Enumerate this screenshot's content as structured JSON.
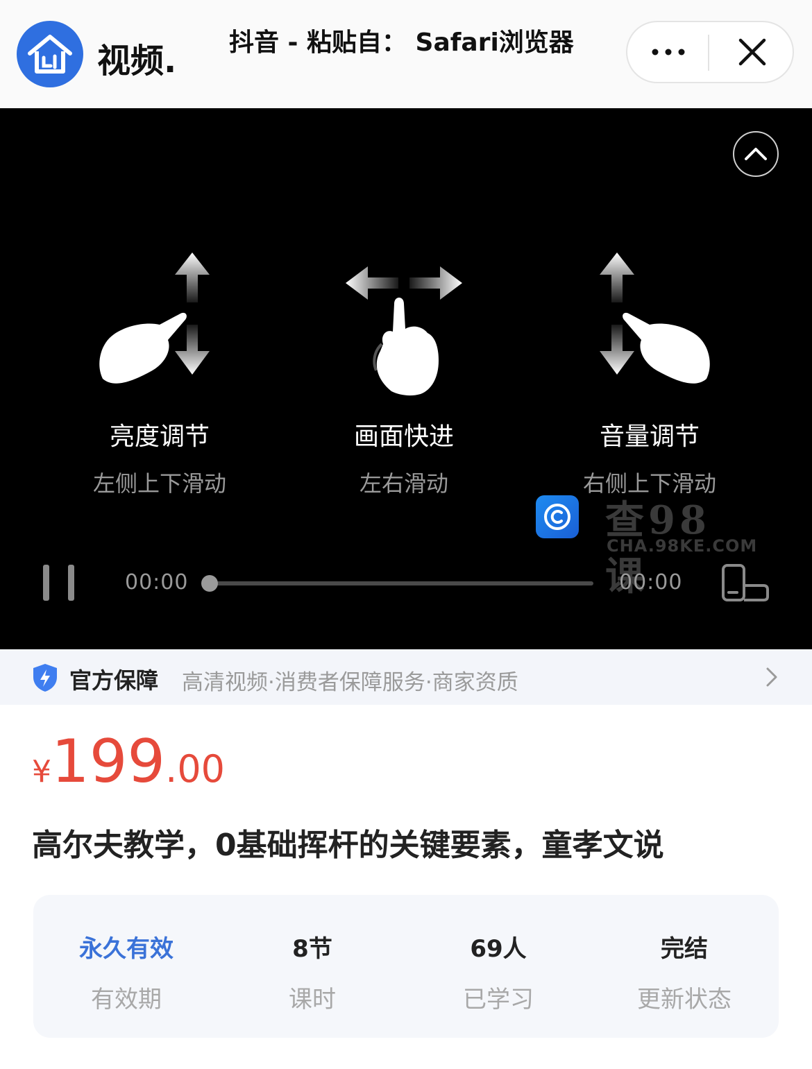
{
  "header": {
    "app_name": "视频.",
    "notice": "抖音 - 粘贴自： Safari浏览器",
    "more_label": "•••",
    "logo_icon": "house-logo-icon",
    "close_icon": "close-icon"
  },
  "player": {
    "gestures": [
      {
        "title": "亮度调节",
        "subtitle": "左侧上下滑动",
        "icon": "swipe-vertical-left-icon"
      },
      {
        "title": "画面快进",
        "subtitle": "左右滑动",
        "icon": "swipe-horizontal-icon"
      },
      {
        "title": "音量调节",
        "subtitle": "右侧上下滑动",
        "icon": "swipe-vertical-right-icon"
      }
    ],
    "current_time": "00:00",
    "total_time": "00:00",
    "progress": 0,
    "watermark": {
      "cn": "查98课",
      "en": "CHA.98KE.COM"
    }
  },
  "guarantee": {
    "label": "官方保障",
    "items": "高清视频·消费者保障服务·商家资质"
  },
  "product": {
    "price_currency": "¥",
    "price_integer": "199",
    "price_decimal": ".00",
    "title": "高尔夫教学，0基础挥杆的关键要素，童孝文说"
  },
  "stats": [
    {
      "value": "永久有效",
      "label": "有效期"
    },
    {
      "value": "8节",
      "label": "课时"
    },
    {
      "value": "69人",
      "label": "已学习"
    },
    {
      "value": "完结",
      "label": "更新状态"
    }
  ],
  "colors": {
    "price": "#e64a3b",
    "accent_blue": "#3a72d8",
    "logo_blue": "#2f6fe0"
  }
}
